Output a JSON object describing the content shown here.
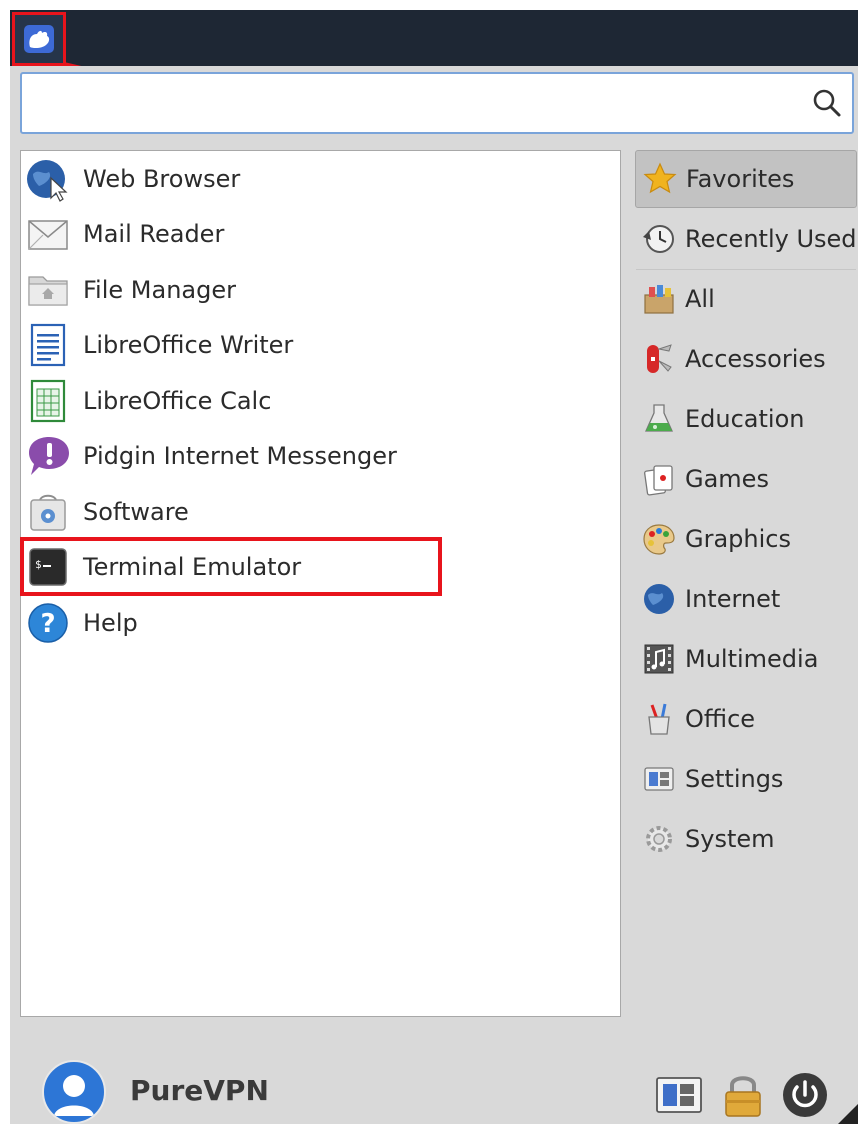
{
  "search": {
    "value": "",
    "placeholder": ""
  },
  "apps": [
    {
      "label": "Web Browser",
      "icon": "web-browser-globe-icon"
    },
    {
      "label": "Mail Reader",
      "icon": "mail-envelope-icon"
    },
    {
      "label": "File Manager",
      "icon": "folder-home-icon"
    },
    {
      "label": "LibreOffice Writer",
      "icon": "writer-document-icon"
    },
    {
      "label": "LibreOffice Calc",
      "icon": "calc-spreadsheet-icon"
    },
    {
      "label": "Pidgin Internet Messenger",
      "icon": "pidgin-speech-bubble-icon"
    },
    {
      "label": "Software",
      "icon": "software-store-icon"
    },
    {
      "label": "Terminal Emulator",
      "icon": "terminal-icon"
    },
    {
      "label": "Help",
      "icon": "help-question-icon"
    }
  ],
  "categories": [
    {
      "label": "Favorites",
      "icon": "star-icon",
      "selected": true
    },
    {
      "label": "Recently Used",
      "icon": "clock-history-icon"
    },
    {
      "label": "All",
      "icon": "box-all-icon"
    },
    {
      "label": "Accessories",
      "icon": "swiss-knife-icon"
    },
    {
      "label": "Education",
      "icon": "flask-icon"
    },
    {
      "label": "Games",
      "icon": "cards-icon"
    },
    {
      "label": "Graphics",
      "icon": "palette-icon"
    },
    {
      "label": "Internet",
      "icon": "globe-icon"
    },
    {
      "label": "Multimedia",
      "icon": "film-music-icon"
    },
    {
      "label": "Office",
      "icon": "pencil-cup-icon"
    },
    {
      "label": "Settings",
      "icon": "settings-panel-icon"
    },
    {
      "label": "System",
      "icon": "gear-icon"
    }
  ],
  "user": {
    "name": "PureVPN"
  },
  "colors": {
    "highlight": "#e8141c",
    "panel": "#1e2734",
    "menu_bg": "#d9d9d9"
  }
}
